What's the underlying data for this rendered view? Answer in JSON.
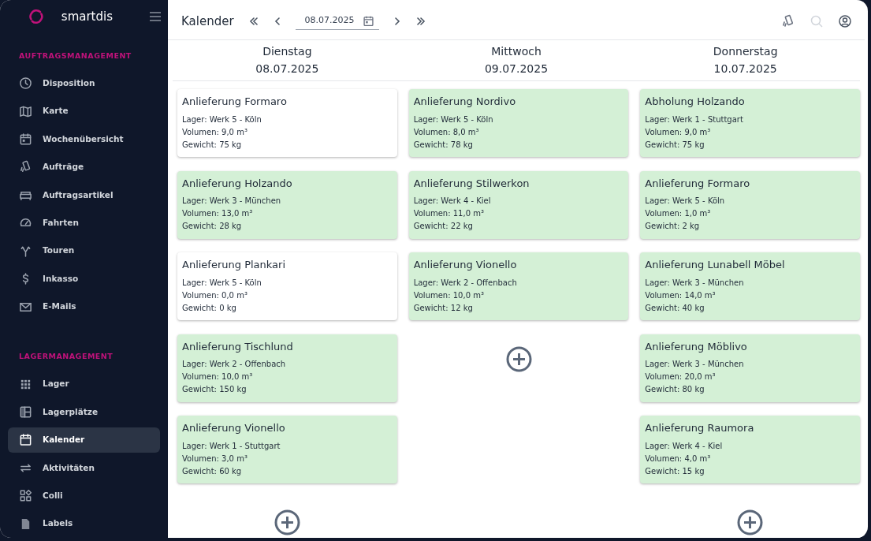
{
  "brand": {
    "name": "smartdis"
  },
  "sidebar": {
    "sections": [
      {
        "title": "AUFTRAGSMANAGEMENT",
        "items": [
          {
            "label": "Disposition",
            "selected": false
          },
          {
            "label": "Karte",
            "selected": false
          },
          {
            "label": "Wochenübersicht",
            "selected": false
          },
          {
            "label": "Aufträge",
            "selected": false
          },
          {
            "label": "Auftragsartikel",
            "selected": false
          },
          {
            "label": "Fahrten",
            "selected": false
          },
          {
            "label": "Touren",
            "selected": false
          },
          {
            "label": "Inkasso",
            "selected": false
          },
          {
            "label": "E-Mails",
            "selected": false
          }
        ]
      },
      {
        "title": "LAGERMANAGEMENT",
        "items": [
          {
            "label": "Lager",
            "selected": false
          },
          {
            "label": "Lagerplätze",
            "selected": false
          },
          {
            "label": "Kalender",
            "selected": true
          },
          {
            "label": "Aktivitäten",
            "selected": false
          },
          {
            "label": "Colli",
            "selected": false
          },
          {
            "label": "Labels",
            "selected": false
          }
        ]
      }
    ]
  },
  "toolbar": {
    "title": "Kalender",
    "date": "08.07.2025"
  },
  "days": [
    {
      "weekday": "Dienstag",
      "date": "08.07.2025",
      "cards": [
        {
          "title": "Anlieferung Formaro",
          "lines": [
            "Lager: Werk 5 - Köln",
            "Volumen: 9,0 m³",
            "Gewicht: 75 kg"
          ],
          "color": "#ffffff"
        },
        {
          "title": "Anlieferung Holzando",
          "lines": [
            "Lager: Werk 3 - München",
            "Volumen: 13,0 m³",
            "Gewicht: 28 kg"
          ],
          "color": "#d4f0d6"
        },
        {
          "title": "Anlieferung Plankari",
          "lines": [
            "Lager: Werk 5 - Köln",
            "Volumen: 0,0 m³",
            "Gewicht: 0 kg"
          ],
          "color": "#ffffff"
        },
        {
          "title": "Anlieferung Tischlund",
          "lines": [
            "Lager: Werk 2 - Offenbach",
            "Volumen: 10,0 m³",
            "Gewicht: 150 kg"
          ],
          "color": "#d4f0d6"
        },
        {
          "title": "Anlieferung Vionello",
          "lines": [
            "Lager: Werk 1 - Stuttgart",
            "Volumen: 3,0 m³",
            "Gewicht: 60 kg"
          ],
          "color": "#d4f0d6"
        }
      ]
    },
    {
      "weekday": "Mittwoch",
      "date": "09.07.2025",
      "cards": [
        {
          "title": "Anlieferung Nordivo",
          "lines": [
            "Lager: Werk 5 - Köln",
            "Volumen: 8,0 m³",
            "Gewicht: 78 kg"
          ],
          "color": "#d4f0d6"
        },
        {
          "title": "Anlieferung Stilwerkon",
          "lines": [
            "Lager: Werk 4 - Kiel",
            "Volumen: 11,0 m³",
            "Gewicht: 22 kg"
          ],
          "color": "#d4f0d6"
        },
        {
          "title": "Anlieferung Vionello",
          "lines": [
            "Lager: Werk 2 - Offenbach",
            "Volumen: 10,0 m³",
            "Gewicht: 12 kg"
          ],
          "color": "#d4f0d6"
        }
      ]
    },
    {
      "weekday": "Donnerstag",
      "date": "10.07.2025",
      "cards": [
        {
          "title": "Abholung Holzando",
          "lines": [
            "Lager: Werk 1 - Stuttgart",
            "Volumen: 9,0 m³",
            "Gewicht: 75 kg"
          ],
          "color": "#d4f0d6"
        },
        {
          "title": "Anlieferung Formaro",
          "lines": [
            "Lager: Werk 5 - Köln",
            "Volumen: 1,0 m³",
            "Gewicht: 2 kg"
          ],
          "color": "#d4f0d6"
        },
        {
          "title": "Anlieferung Lunabell Möbel",
          "lines": [
            "Lager: Werk 3 - München",
            "Volumen: 14,0 m³",
            "Gewicht: 40 kg"
          ],
          "color": "#d4f0d6"
        },
        {
          "title": "Anlieferung Möblivo",
          "lines": [
            "Lager: Werk 3 - München",
            "Volumen: 20,0 m³",
            "Gewicht: 80 kg"
          ],
          "color": "#d4f0d6"
        },
        {
          "title": "Anlieferung Raumora",
          "lines": [
            "Lager: Werk 4 - Kiel",
            "Volumen: 4,0 m³",
            "Gewicht: 15 kg"
          ],
          "color": "#d4f0d6"
        }
      ]
    }
  ]
}
